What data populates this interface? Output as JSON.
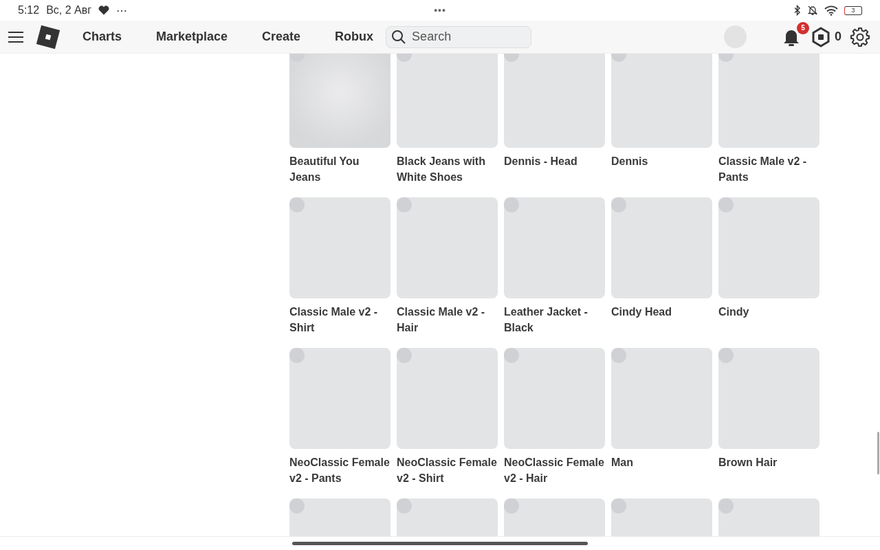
{
  "status_bar": {
    "time": "5:12",
    "date": "Вс, 2 Авг",
    "more": "⋯",
    "center_dots": "•••",
    "battery": "3"
  },
  "nav": {
    "links": [
      "Charts",
      "Marketplace",
      "Create",
      "Robux"
    ],
    "search": {
      "placeholder": "Search"
    },
    "notifications": "5",
    "robux": "0"
  },
  "items": [
    {
      "name": "Beautiful You Jeans",
      "kind": "shaded"
    },
    {
      "name": "Black Jeans with White Shoes",
      "kind": "plain"
    },
    {
      "name": "Dennis - Head",
      "kind": "plain"
    },
    {
      "name": "Dennis",
      "kind": "plain"
    },
    {
      "name": "Classic Male v2 - Pants",
      "kind": "plain"
    },
    {
      "name": "Classic Male v2 - Shirt",
      "kind": "plain"
    },
    {
      "name": "Classic Male v2 - Hair",
      "kind": "plain"
    },
    {
      "name": "Leather Jacket - Black",
      "kind": "plain"
    },
    {
      "name": "Cindy Head",
      "kind": "plain"
    },
    {
      "name": "Cindy",
      "kind": "plain"
    },
    {
      "name": "NeoClassic Female v2 - Pants",
      "kind": "plain"
    },
    {
      "name": "NeoClassic Female v2 - Shirt",
      "kind": "plain"
    },
    {
      "name": "NeoClassic Female v2 - Hair",
      "kind": "plain"
    },
    {
      "name": "Man",
      "kind": "plain"
    },
    {
      "name": "Brown Hair",
      "kind": "plain"
    },
    {
      "kind": "plain"
    },
    {
      "kind": "plain"
    },
    {
      "kind": "plain"
    },
    {
      "kind": "plain"
    },
    {
      "kind": "plain"
    }
  ]
}
